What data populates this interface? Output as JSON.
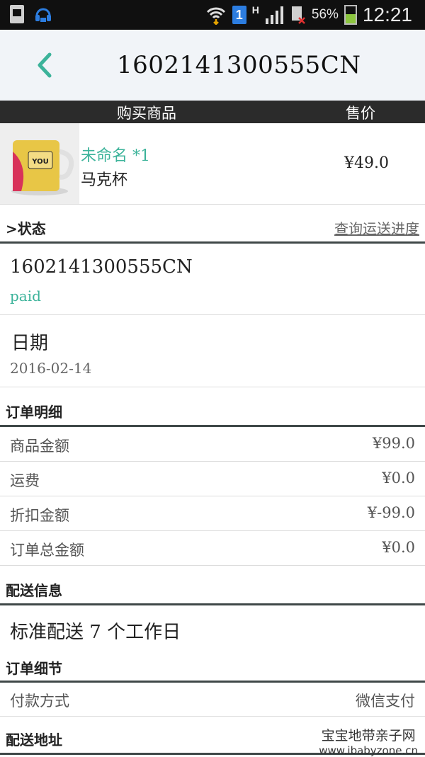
{
  "status_bar": {
    "battery_percent": "56%",
    "time": "12:21",
    "network": "H",
    "sim_slot": "1",
    "battery_level": 0.56
  },
  "app_bar": {
    "title": "1602141300555CN"
  },
  "columns": {
    "product": "购买商品",
    "price": "售价"
  },
  "product": {
    "name": "未命名 *1",
    "subtitle": "马克杯",
    "price": "¥49.0"
  },
  "status_section": {
    "heading": ">状态",
    "track_link": "查询运送进度",
    "order_no": "1602141300555CN",
    "state": "paid"
  },
  "date_section": {
    "label": "日期",
    "value": "2016-02-14"
  },
  "order_detail": {
    "heading": "订单明细",
    "rows": [
      {
        "label": "商品金额",
        "value": "¥99.0"
      },
      {
        "label": "运费",
        "value": "¥0.0"
      },
      {
        "label": "折扣金额",
        "value": "¥-99.0"
      },
      {
        "label": "订单总金额",
        "value": "¥0.0"
      }
    ]
  },
  "delivery": {
    "heading": "配送信息",
    "method": "标准配送 7 个工作日"
  },
  "order_info": {
    "heading": "订单细节",
    "payment_label": "付款方式",
    "payment_value": "微信支付"
  },
  "address": {
    "heading": "配送地址"
  },
  "watermark": {
    "line1": "宝宝地带亲子网",
    "line2": "www.ibabyzone.cn"
  }
}
